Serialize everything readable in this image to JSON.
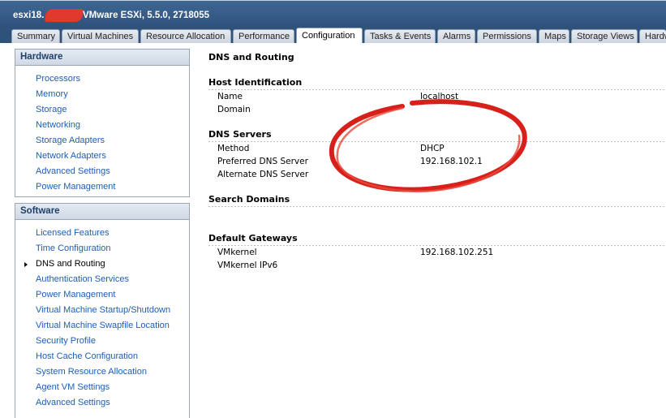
{
  "window": {
    "host_prefix": "esxi18.",
    "title_rest": "VMware ESXi, 5.5.0, 2718055"
  },
  "tabs": [
    {
      "label": "Summary"
    },
    {
      "label": "Virtual Machines"
    },
    {
      "label": "Resource Allocation"
    },
    {
      "label": "Performance"
    },
    {
      "label": "Configuration"
    },
    {
      "label": "Tasks & Events"
    },
    {
      "label": "Alarms"
    },
    {
      "label": "Permissions"
    },
    {
      "label": "Maps"
    },
    {
      "label": "Storage Views"
    },
    {
      "label": "Hardw"
    }
  ],
  "active_tab": "Configuration",
  "hardware": {
    "header": "Hardware",
    "items": [
      "Processors",
      "Memory",
      "Storage",
      "Networking",
      "Storage Adapters",
      "Network Adapters",
      "Advanced Settings",
      "Power Management"
    ]
  },
  "software": {
    "header": "Software",
    "items": [
      "Licensed Features",
      "Time Configuration",
      "DNS and Routing",
      "Authentication Services",
      "Power Management",
      "Virtual Machine Startup/Shutdown",
      "Virtual Machine Swapfile Location",
      "Security Profile",
      "Host Cache Configuration",
      "System Resource Allocation",
      "Agent VM Settings",
      "Advanced Settings"
    ],
    "selected": "DNS and Routing"
  },
  "details": {
    "title": "DNS and Routing",
    "host_identification": {
      "heading": "Host Identification",
      "name_label": "Name",
      "name_value": "localhost",
      "domain_label": "Domain",
      "domain_value": ""
    },
    "dns_servers": {
      "heading": "DNS Servers",
      "method_label": "Method",
      "method_value": "DHCP",
      "preferred_label": "Preferred DNS Server",
      "preferred_value": "192.168.102.1",
      "alternate_label": "Alternate DNS Server",
      "alternate_value": ""
    },
    "search_domains": {
      "heading": "Search Domains"
    },
    "default_gateways": {
      "heading": "Default Gateways",
      "vmkernel_label": "VMkernel",
      "vmkernel_value": "192.168.102.251",
      "vmkernel_ipv6_label": "VMkernel IPv6",
      "vmkernel_ipv6_value": ""
    }
  },
  "colors": {
    "titlebar": "#2f527b",
    "link": "#1e5eb4",
    "annotation": "#d8201a"
  }
}
